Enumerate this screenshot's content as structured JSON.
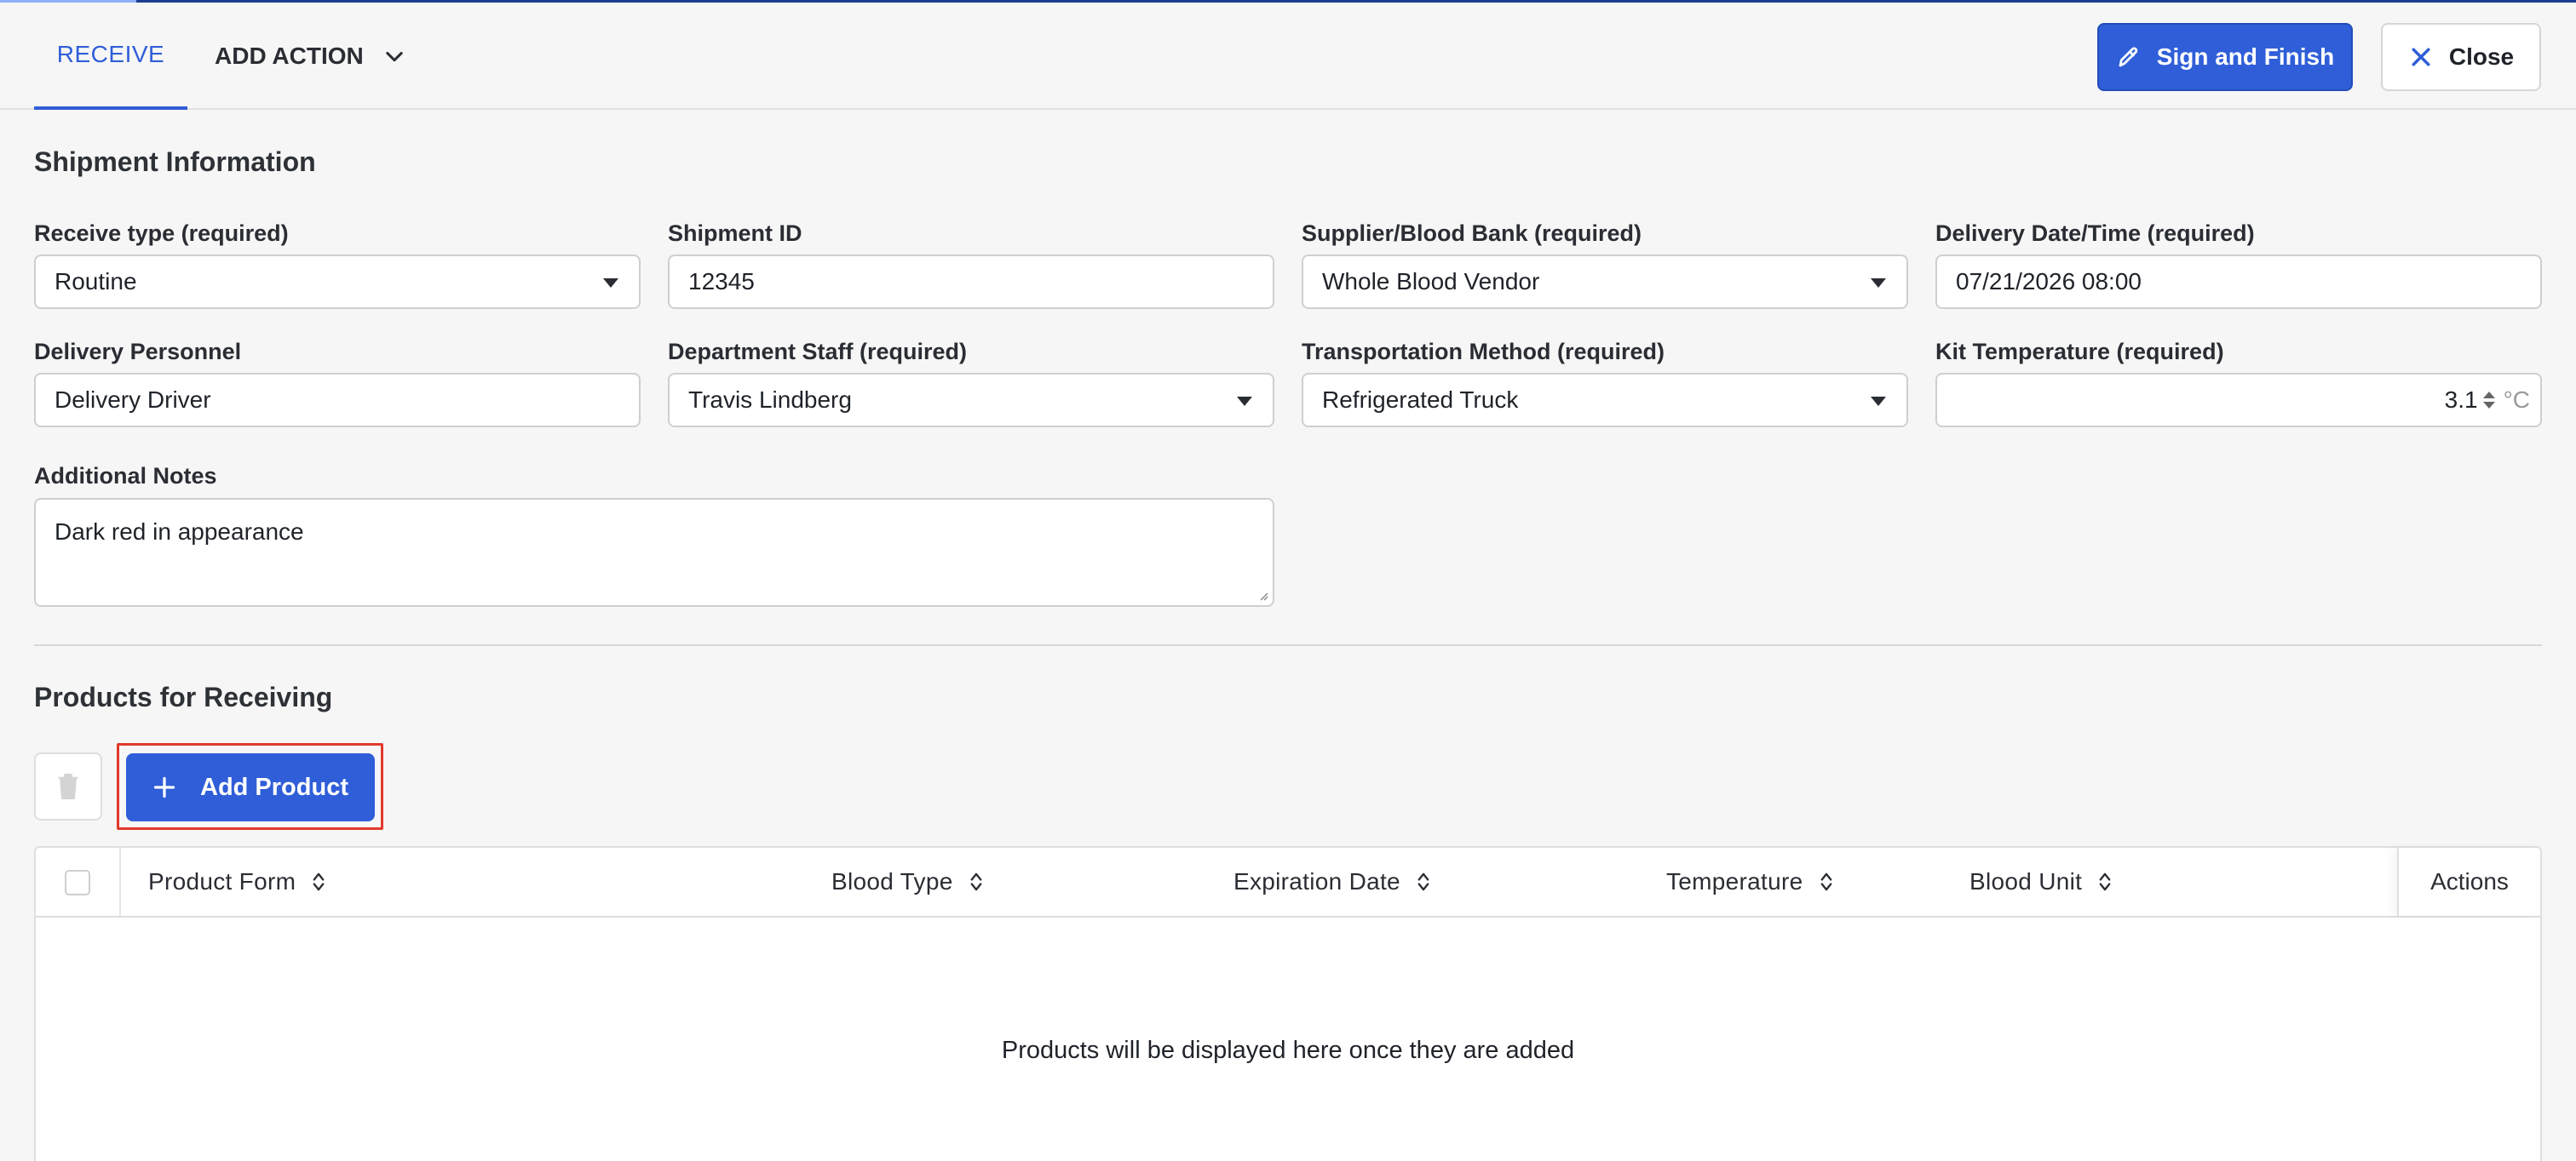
{
  "header": {
    "tab_receive": "RECEIVE",
    "tab_add_action": "ADD ACTION",
    "sign_button": "Sign and Finish",
    "close_button": "Close"
  },
  "shipment": {
    "title": "Shipment Information",
    "receive_type": {
      "label": "Receive type (required)",
      "value": "Routine"
    },
    "shipment_id": {
      "label": "Shipment ID",
      "value": "12345"
    },
    "supplier": {
      "label": "Supplier/Blood Bank (required)",
      "value": "Whole Blood Vendor"
    },
    "delivery_datetime": {
      "label": "Delivery Date/Time (required)",
      "value": "07/21/2026 08:00"
    },
    "delivery_personnel": {
      "label": "Delivery Personnel",
      "value": "Delivery Driver"
    },
    "department_staff": {
      "label": "Department Staff (required)",
      "value": "Travis Lindberg"
    },
    "transportation": {
      "label": "Transportation Method (required)",
      "value": "Refrigerated Truck"
    },
    "kit_temperature": {
      "label": "Kit Temperature (required)",
      "value": "3.1",
      "unit": "°C"
    },
    "notes": {
      "label": "Additional Notes",
      "value": "Dark red in appearance"
    }
  },
  "products": {
    "title": "Products for Receiving",
    "add_button": "Add Product",
    "columns": [
      "Product Form",
      "Blood Type",
      "Expiration Date",
      "Temperature",
      "Blood Unit"
    ],
    "actions_column": "Actions",
    "empty_message": "Products will be displayed here once they are added"
  },
  "colors": {
    "accent": "#2f5ed8",
    "highlight": "#e0392b"
  }
}
